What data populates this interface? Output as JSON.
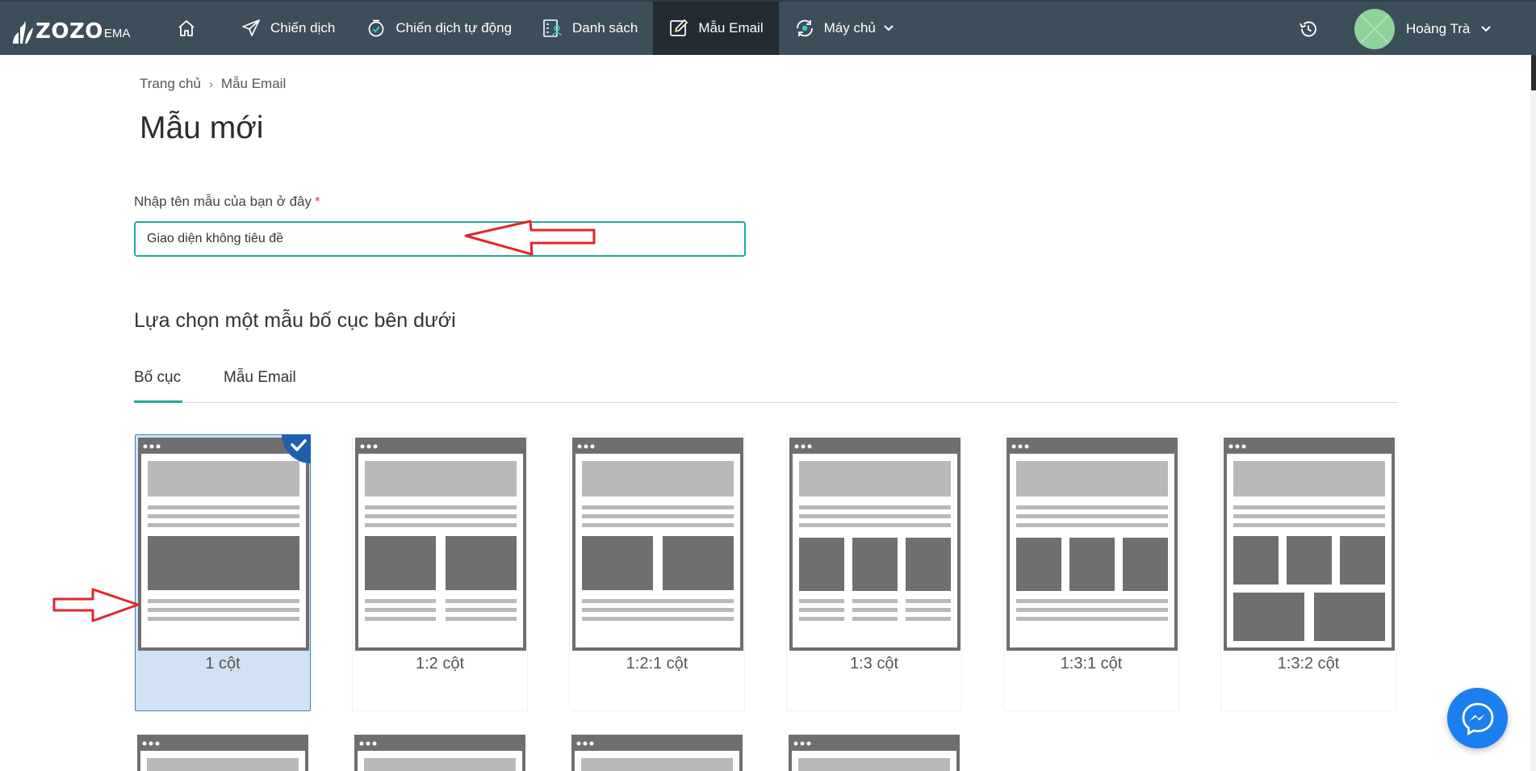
{
  "app": {
    "logo_text": "ZOZO",
    "logo_sub": "EMA"
  },
  "nav": {
    "items": [
      {
        "label": "",
        "icon": "home-icon"
      },
      {
        "label": "Chiến dịch",
        "icon": "paper-plane-icon"
      },
      {
        "label": "Chiến dịch tự động",
        "icon": "auto-campaign-icon"
      },
      {
        "label": "Danh sách",
        "icon": "contact-list-icon"
      },
      {
        "label": "Mẫu Email",
        "icon": "edit-template-icon",
        "active": true
      },
      {
        "label": "Máy chủ",
        "icon": "server-sync-icon",
        "dropdown": true
      }
    ],
    "user_name": "Hoàng Trà",
    "active_color": "#232c33",
    "bar_color": "#3d4e5b"
  },
  "breadcrumb": {
    "home": "Trang chủ",
    "separator": "›",
    "current": "Mẫu Email"
  },
  "page": {
    "title": "Mẫu mới"
  },
  "form": {
    "name_label": "Nhập tên mẫu của bạn ở đây",
    "required_mark": "*",
    "name_value": "Giao diện không tiêu đề",
    "accent_color": "#27a59b"
  },
  "layout_section": {
    "title": "Lựa chọn một mẫu bố cục bên dưới",
    "tabs": [
      {
        "label": "Bố cục",
        "active": true
      },
      {
        "label": "Mẫu Email",
        "active": false
      }
    ]
  },
  "layouts": [
    {
      "label": "1 cột",
      "selected": true
    },
    {
      "label": "1:2 cột",
      "selected": false
    },
    {
      "label": "1:2:1 cột",
      "selected": false
    },
    {
      "label": "1:3 cột",
      "selected": false
    },
    {
      "label": "1:3:1 cột",
      "selected": false
    },
    {
      "label": "1:3:2 cột",
      "selected": false
    }
  ],
  "annotations": {
    "arrow_color": "#e2262b"
  }
}
